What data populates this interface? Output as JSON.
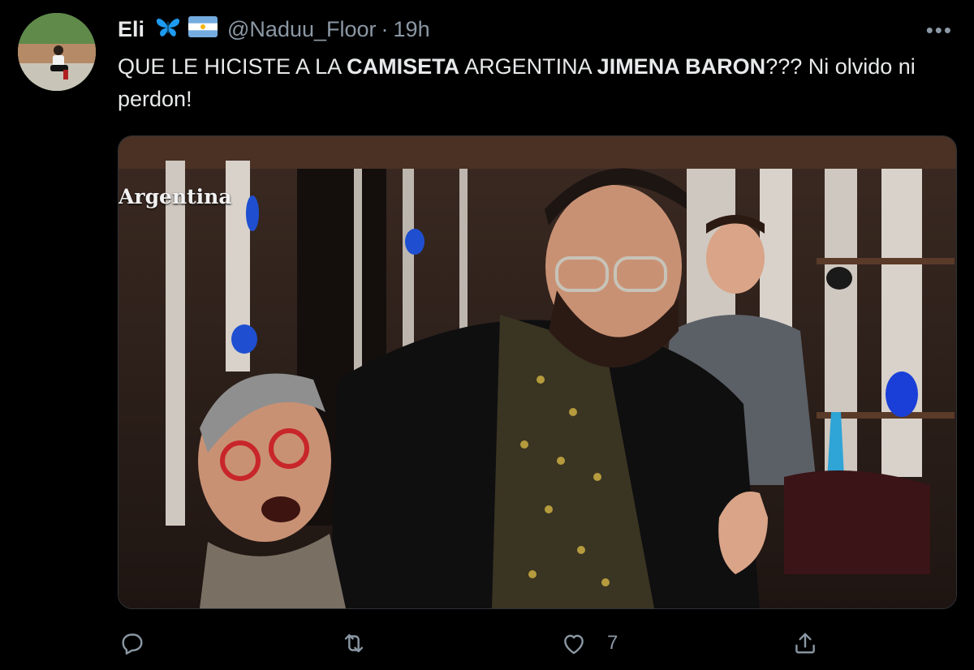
{
  "tweet": {
    "display_name": "Eli",
    "handle": "@Naduu_Floor",
    "separator": "·",
    "time": "19h",
    "more_label": "•••",
    "text_parts": [
      {
        "t": "QUE LE HICISTE A LA ",
        "bold": false
      },
      {
        "t": "CAMISETA",
        "bold": true
      },
      {
        "t": " ARGENTINA ",
        "bold": false
      },
      {
        "t": "JIMENA BARON",
        "bold": true
      },
      {
        "t": "??? Ni olvido ni perdon!",
        "bold": false
      }
    ],
    "media": {
      "overlay_text": "Argentina"
    },
    "actions": {
      "reply_icon": "reply-icon",
      "retweet_icon": "retweet-icon",
      "like_icon": "heart-icon",
      "like_count": "7",
      "share_icon": "share-icon"
    },
    "header_emojis": [
      "butterfly-icon",
      "argentina-flag-icon"
    ]
  },
  "colors": {
    "background": "#000000",
    "text": "#e7e9ea",
    "secondary": "#8b98a5",
    "butterfly": "#1d9bf0",
    "flag_blue": "#74acdf",
    "flag_sun": "#f6b40e"
  }
}
